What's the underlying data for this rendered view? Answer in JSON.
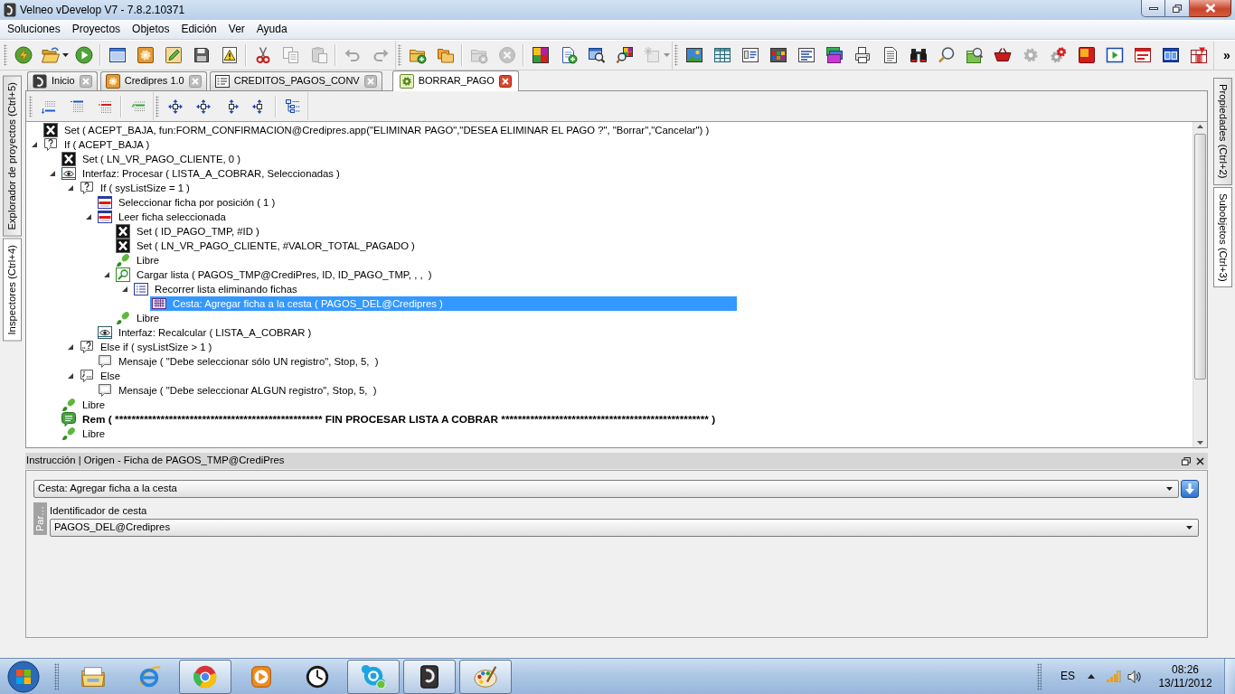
{
  "window": {
    "title": "Velneo vDevelop V7 - 7.8.2.10371"
  },
  "menu": [
    "Soluciones",
    "Proyectos",
    "Objetos",
    "Edición",
    "Ver",
    "Ayuda"
  ],
  "toolbars": [
    [
      [
        {
          "kind": "lightning",
          "disabled": false
        },
        {
          "kind": "open",
          "disabled": false
        },
        {
          "kind": "run",
          "disabled": false
        }
      ],
      [
        {
          "kind": "window",
          "disabled": false
        },
        {
          "kind": "module",
          "disabled": false
        },
        {
          "kind": "edit",
          "disabled": false
        },
        {
          "kind": "save",
          "disabled": false
        },
        {
          "kind": "warning",
          "disabled": false
        }
      ],
      [
        {
          "kind": "cut",
          "disabled": false
        },
        {
          "kind": "copy",
          "disabled": true
        },
        {
          "kind": "paste",
          "disabled": true
        }
      ],
      [
        {
          "kind": "undo",
          "disabled": true
        },
        {
          "kind": "redo",
          "disabled": true
        }
      ]
    ],
    [
      [
        {
          "kind": "newfolder",
          "disabled": false
        },
        {
          "kind": "folders",
          "disabled": false
        }
      ],
      [
        {
          "kind": "delfolder",
          "disabled": true
        },
        {
          "kind": "remove",
          "disabled": true
        }
      ],
      [
        {
          "kind": "colors",
          "disabled": false
        },
        {
          "kind": "newdoc",
          "disabled": false
        },
        {
          "kind": "findwindow",
          "disabled": false
        },
        {
          "kind": "findcolor",
          "disabled": false
        },
        {
          "kind": "sparkle",
          "disabled": true
        }
      ]
    ],
    [
      [
        {
          "kind": "image",
          "disabled": false
        },
        {
          "kind": "table",
          "disabled": false
        },
        {
          "kind": "form",
          "disabled": false
        },
        {
          "kind": "palette",
          "disabled": false
        },
        {
          "kind": "list",
          "disabled": false
        },
        {
          "kind": "stack",
          "disabled": false
        },
        {
          "kind": "printer",
          "disabled": false
        },
        {
          "kind": "document",
          "disabled": false
        },
        {
          "kind": "binoculars",
          "disabled": false
        },
        {
          "kind": "search",
          "disabled": false
        },
        {
          "kind": "preview",
          "disabled": false
        },
        {
          "kind": "basket",
          "disabled": false
        },
        {
          "kind": "gear",
          "disabled": false
        },
        {
          "kind": "gears",
          "disabled": false
        },
        {
          "kind": "square",
          "disabled": false
        },
        {
          "kind": "playwindow",
          "disabled": false
        },
        {
          "kind": "barwindow",
          "disabled": false
        },
        {
          "kind": "splitwindow",
          "disabled": false
        },
        {
          "kind": "chart",
          "disabled": false
        }
      ]
    ]
  ],
  "toolbar_overflow": "»",
  "left_tabs": [
    {
      "label": "Explorador de proyectos (Ctrl+5)",
      "selected": false
    },
    {
      "label": "Inspectores (Ctrl+4)",
      "selected": true
    }
  ],
  "document_tabs": [
    {
      "kind": "home",
      "label": "Inicio",
      "selected": false
    },
    {
      "kind": "project",
      "label": "Credipres 1.0",
      "selected": false
    },
    {
      "kind": "form",
      "label": "CREDITOS_PAGOS_CONV",
      "selected": false
    },
    {
      "kind": "process",
      "label": "BORRAR_PAGO",
      "selected": true
    }
  ],
  "editor_toolbars": [
    [
      [
        {
          "kind": "insertafter"
        },
        {
          "kind": "insertbefore"
        },
        {
          "kind": "deleteline"
        }
      ],
      [
        {
          "kind": "commentline"
        }
      ]
    ],
    [
      [
        {
          "kind": "moveall"
        },
        {
          "kind": "movevertical"
        },
        {
          "kind": "moveright"
        },
        {
          "kind": "moveleft"
        }
      ],
      [
        {
          "kind": "tree"
        }
      ]
    ]
  ],
  "tree": [
    {
      "kind": "set",
      "text": "Set ( ACEPT_BAJA, fun:FORM_CONFIRMACION@Credipres.app(\"ELIMINAR PAGO\",\"DESEA ELIMINAR EL PAGO ?\", \"Borrar\",\"Cancelar\") )",
      "selected": false
    },
    {
      "kind": "if",
      "text": "If ( ACEPT_BAJA )",
      "expanded": true,
      "selected": false,
      "children": [
        {
          "kind": "set",
          "text": "Set ( LN_VR_PAGO_CLIENTE, 0 )",
          "selected": false
        },
        {
          "kind": "interface",
          "text": "Interfaz: Procesar ( LISTA_A_COBRAR, Seleccionadas )",
          "expanded": true,
          "selected": false,
          "children": [
            {
              "kind": "if",
              "text": "If ( sysListSize = 1 )",
              "expanded": true,
              "selected": false,
              "children": [
                {
                  "kind": "select",
                  "text": "Seleccionar ficha por posición ( 1 )",
                  "selected": false
                },
                {
                  "kind": "read",
                  "text": "Leer ficha seleccionada",
                  "expanded": true,
                  "selected": false,
                  "children": [
                    {
                      "kind": "set",
                      "text": "Set ( ID_PAGO_TMP, #ID )",
                      "selected": false
                    },
                    {
                      "kind": "set",
                      "text": "Set ( LN_VR_PAGO_CLIENTE, #VALOR_TOTAL_PAGADO )",
                      "selected": false
                    },
                    {
                      "kind": "free",
                      "text": "Libre",
                      "selected": false
                    },
                    {
                      "kind": "load",
                      "text": "Cargar lista ( PAGOS_TMP@CrediPres, ID, ID_PAGO_TMP, , ,  )",
                      "expanded": true,
                      "selected": false,
                      "children": [
                        {
                          "kind": "loop",
                          "text": "Recorrer lista eliminando fichas",
                          "expanded": true,
                          "selected": false,
                          "children": [
                            {
                              "kind": "basket",
                              "text": "Cesta: Agregar ficha a la cesta ( PAGOS_DEL@Credipres )",
                              "selected": true
                            }
                          ]
                        }
                      ]
                    },
                    {
                      "kind": "free",
                      "text": "Libre",
                      "selected": false
                    }
                  ]
                },
                {
                  "kind": "interface",
                  "text": "Interfaz: Recalcular ( LISTA_A_COBRAR )",
                  "selected": false
                }
              ]
            },
            {
              "kind": "elseif",
              "text": "Else if ( sysListSize > 1 )",
              "expanded": true,
              "selected": false,
              "children": [
                {
                  "kind": "message",
                  "text": "Mensaje ( \"Debe seleccionar sólo UN registro\", Stop, 5,  )",
                  "selected": false
                }
              ]
            },
            {
              "kind": "else",
              "text": "Else",
              "expanded": true,
              "selected": false,
              "children": [
                {
                  "kind": "message",
                  "text": "Mensaje ( \"Debe seleccionar ALGUN registro\", Stop, 5,  )",
                  "selected": false
                }
              ]
            }
          ]
        },
        {
          "kind": "free",
          "text": "Libre",
          "selected": false
        },
        {
          "kind": "rem",
          "text": "Rem ( ************************************************** FIN PROCESAR LISTA A COBRAR ************************************************** )",
          "selected": false
        },
        {
          "kind": "free",
          "text": "Libre",
          "selected": false
        }
      ]
    }
  ],
  "instruction_panel": {
    "title": "Instrucción | Origen - Ficha de PAGOS_TMP@CrediPres",
    "instruction": "Cesta: Agregar ficha a la cesta",
    "side_tab": "Par…",
    "parameter_label": "Identificador de cesta",
    "parameter_value": "PAGOS_DEL@Credipres"
  },
  "right_tabs": [
    {
      "label": "Propiedades (Ctrl+2)",
      "selected": false
    },
    {
      "label": "Subobjetos (Ctrl+3)",
      "selected": true
    }
  ],
  "taskbar": {
    "apps": [
      {
        "kind": "explorer",
        "running": false
      },
      {
        "kind": "globe",
        "running": false
      },
      {
        "kind": "wheel",
        "running": true
      },
      {
        "kind": "media",
        "running": false
      },
      {
        "kind": "clock",
        "running": false
      },
      {
        "kind": "cloud",
        "running": true
      },
      {
        "kind": "logo",
        "running": true
      },
      {
        "kind": "paint",
        "running": true
      }
    ],
    "language": "ES",
    "time": "08:26",
    "date": "13/11/2012"
  }
}
